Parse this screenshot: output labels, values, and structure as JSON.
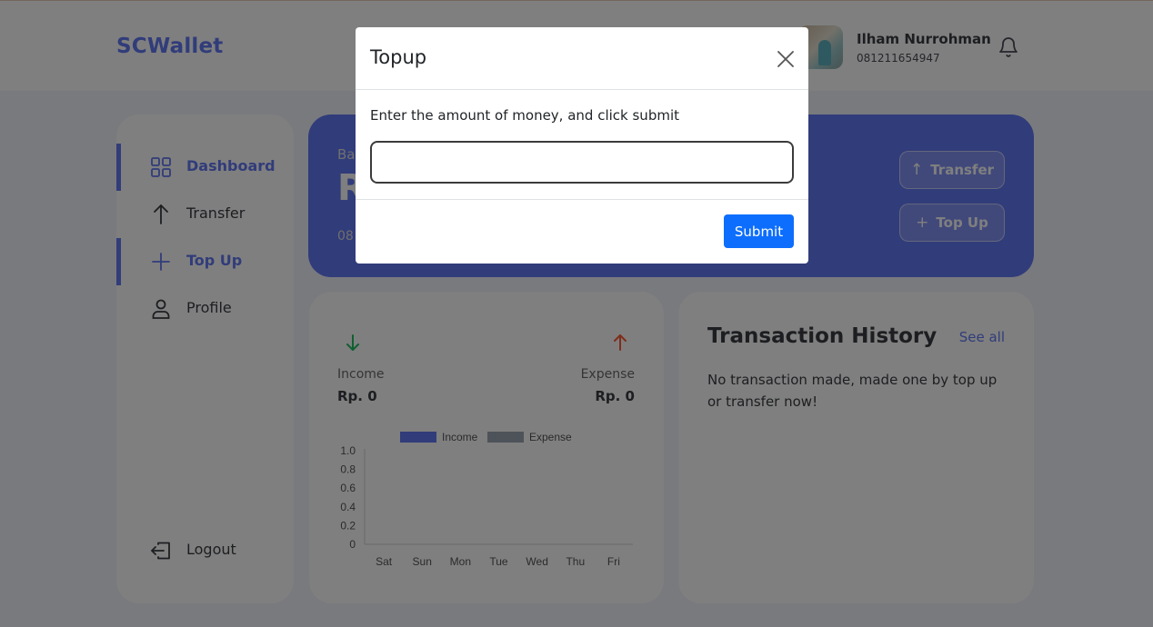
{
  "app": {
    "brand": "SCWallet"
  },
  "user": {
    "name": "Ilham Nurrohman",
    "phone": "081211654947"
  },
  "sidebar": {
    "items": [
      {
        "label": "Dashboard",
        "icon": "grid-icon",
        "active": true
      },
      {
        "label": "Transfer",
        "icon": "arrow-up-icon",
        "active": false
      },
      {
        "label": "Top Up",
        "icon": "plus-icon",
        "active": true
      },
      {
        "label": "Profile",
        "icon": "user-icon",
        "active": false
      }
    ],
    "logout_label": "Logout"
  },
  "balance": {
    "label": "Ba",
    "value": "R",
    "phone": "08",
    "transfer_label": "Transfer",
    "topup_label": "Top Up"
  },
  "stats": {
    "income_label": "Income",
    "income_value": "Rp. 0",
    "expense_label": "Expense",
    "expense_value": "Rp. 0"
  },
  "chart_data": {
    "type": "bar",
    "categories": [
      "Sat",
      "Sun",
      "Mon",
      "Tue",
      "Wed",
      "Thu",
      "Fri"
    ],
    "series": [
      {
        "name": "Income",
        "values": [
          0,
          0,
          0,
          0,
          0,
          0,
          0
        ],
        "color": "#6379f4"
      },
      {
        "name": "Expense",
        "values": [
          0,
          0,
          0,
          0,
          0,
          0,
          0
        ],
        "color": "#9da6b5"
      }
    ],
    "yticks": [
      "1.0",
      "0.8",
      "0.6",
      "0.4",
      "0.2",
      "0"
    ],
    "ylim": [
      0,
      1
    ],
    "legend": "top"
  },
  "history": {
    "title": "Transaction History",
    "see_all": "See all",
    "empty_text": "No transaction made, made one by top up or transfer now!"
  },
  "modal": {
    "title": "Topup",
    "body_text": "Enter the amount of money, and click submit",
    "input_value": "",
    "submit_label": "Submit"
  },
  "colors": {
    "primary": "#6379f4",
    "income_arrow": "#1ec15f",
    "expense_arrow": "#ff5b37",
    "submit": "#0d6efd"
  }
}
